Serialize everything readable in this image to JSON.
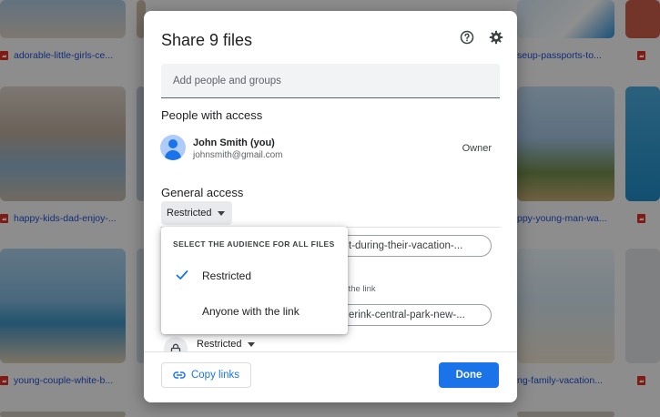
{
  "background": {
    "tiles": [
      {
        "label": "adorable-little-girls-ce..."
      },
      {
        "label": "seup-passports-to..."
      },
      {
        "label": "happy-kids-dad-enjoy-..."
      },
      {
        "label": "ppy-young-man-wa..."
      },
      {
        "label": "young-couple-white-b..."
      },
      {
        "label": "ng-family-vacation..."
      }
    ]
  },
  "dialog": {
    "title": "Share 9 files",
    "help_icon": "help-circle-icon",
    "settings_icon": "gear-icon",
    "add_placeholder": "Add people and groups",
    "people_section_title": "People with access",
    "person": {
      "name": "John Smith (you)",
      "email": "johnsmith@gmail.com",
      "role": "Owner"
    },
    "general_access_title": "General access",
    "general_access_value": "Restricted",
    "file_rows": [
      {
        "name_fragment": "t-during-their-vacation-..."
      },
      {
        "name_fragment": "erink-central-park-new-...",
        "note_fragment": "th the link"
      }
    ],
    "bottom_access_value": "Restricted",
    "copy_links_label": "Copy links",
    "done_label": "Done"
  },
  "menu": {
    "heading": "SELECT THE AUDIENCE FOR ALL FILES",
    "items": [
      {
        "label": "Restricted",
        "selected": true
      },
      {
        "label": "Anyone with the link",
        "selected": false
      }
    ]
  },
  "colors": {
    "accent": "#1a73e8",
    "file_icon": "#d93025",
    "link_text": "#1f4fd1"
  }
}
